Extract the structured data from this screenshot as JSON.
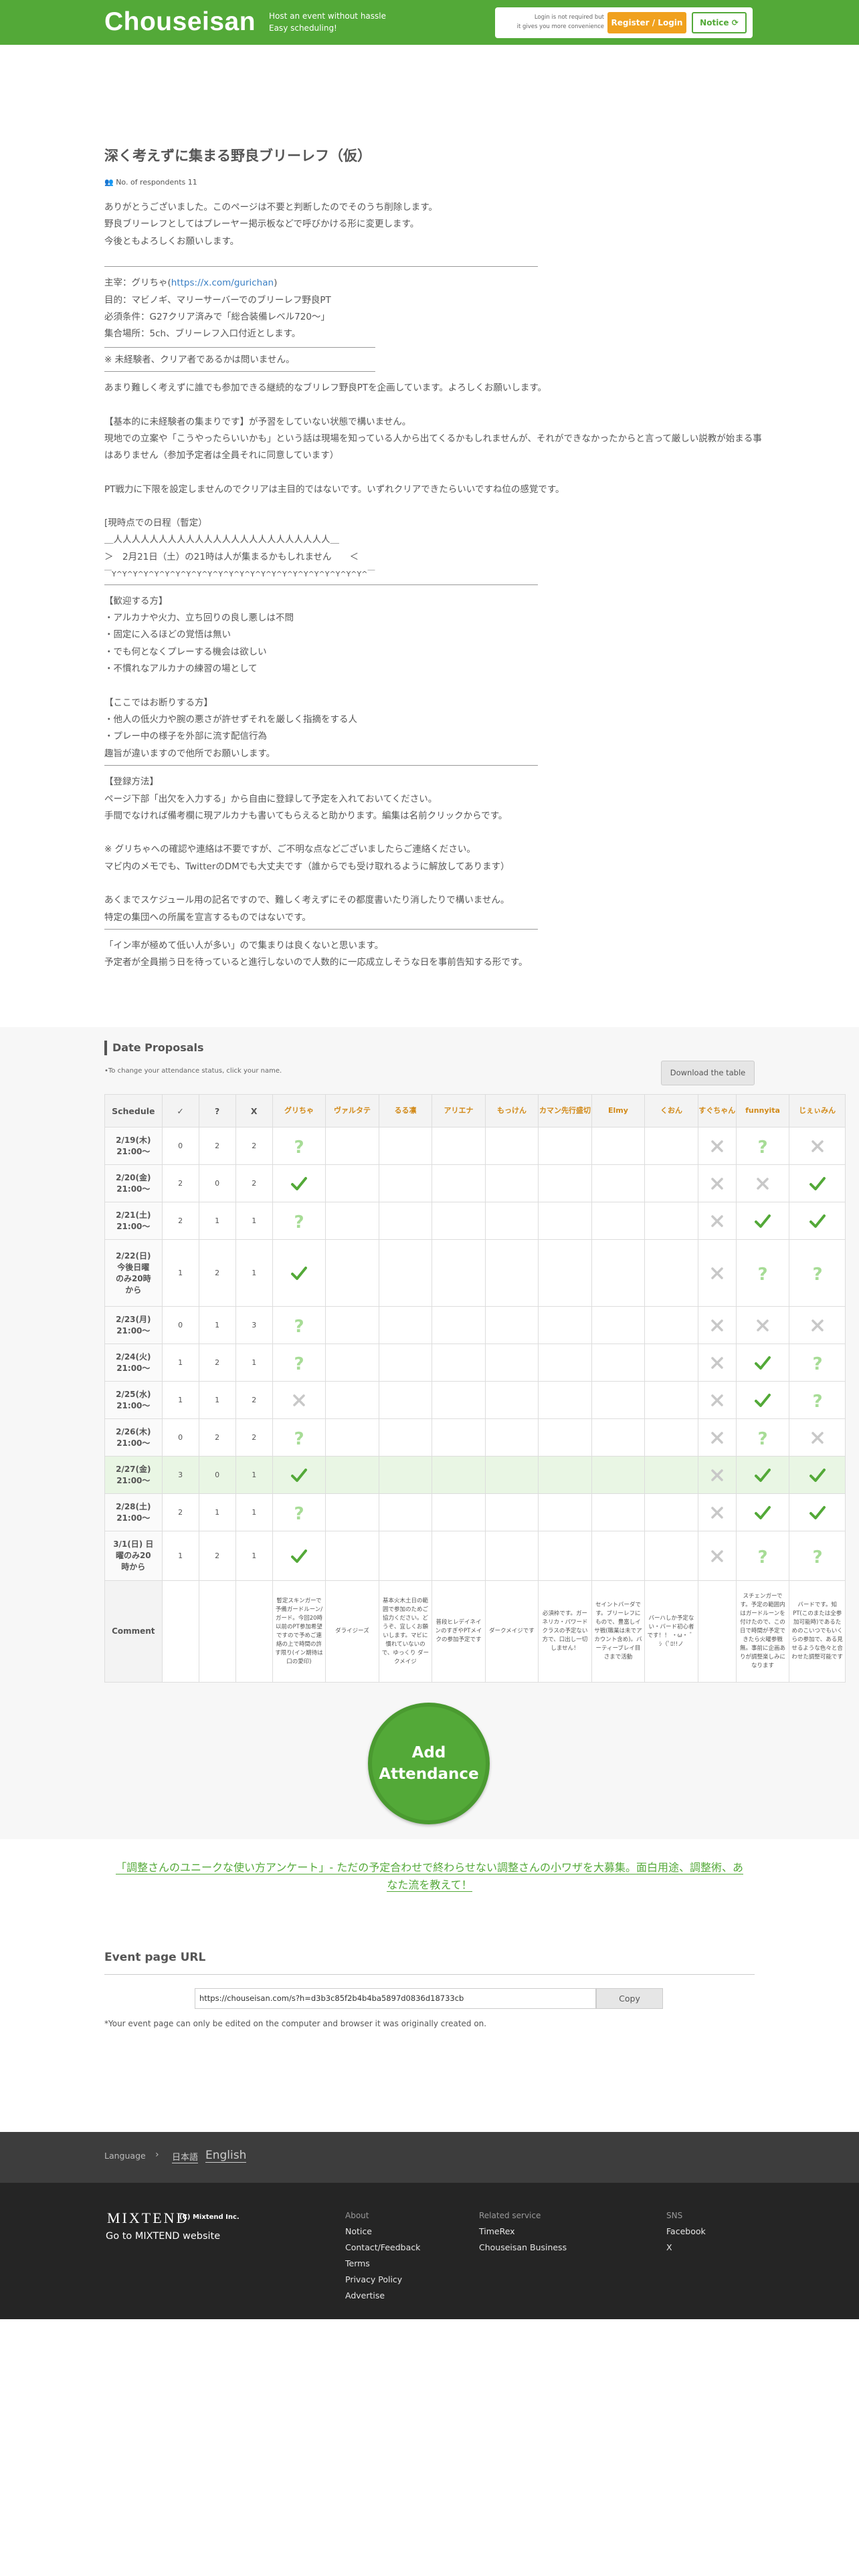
{
  "header": {
    "logo": "Chouseisan",
    "tagline_1": "Host an event without hassle",
    "tagline_2": "Easy scheduling!",
    "login_note_1": "Login is not required but",
    "login_note_2": "it gives you more convenience",
    "register_label": "Register / Login",
    "notice_label": "Notice"
  },
  "event": {
    "title": "深く考えずに集まる野良ブリーレフ（仮）",
    "respondents": "No. of respondents 11",
    "memo_lines": [
      "ありがとうございました。このページは不要と判断したのでそのうち削除します。",
      "野良ブリーレフとしてはプレーヤー掲示板などで呼びかける形に変更します。",
      "今後ともよろしくお願いします。",
      "",
      "主宰：グリちゃ",
      "https://x.com/gurichan",
      "目的：マビノギ、マリーサーバーでのブリーレフ野良PT",
      "必須条件：G27クリア済みで「総合装備レベル720～」",
      "集合場所：5ch、ブリーレフ入口付近とします。",
      "※ 未経験者、クリア者であるかは問いません。",
      "あまり難しく考えずに誰でも参加できる継続的なブリレフ野良PTを企画しています。よろしくお願いします。",
      "【基本的に未経験者の集まりです】が予習をしていない状態で構いません。",
      "現地での立案や「こうやったらいいかも」という話は現場を知っている人から出てくるかもしれませんが、それができなかったからと言って厳しい説教が始まる事はありません（参加予定者は全員それに同意しています）",
      "PT戦力に下限を設定しませんのでクリアは主目的ではないです。いずれクリアできたらいいですね位の感覚です。",
      "[現時点での日程（暫定）",
      "＿人人人人人人人人人人人人人人人人人人人人人人人人＿",
      "＞　2月21日（土）の21時は人が集まるかもしれません　　＜",
      "￣Y^Y^Y^Y^Y^Y^Y^Y^Y^Y^Y^Y^Y^Y^Y^Y^Y^Y^Y^Y^Y^Y^Y^Y^￣",
      "【歓迎する方】",
      "・アルカナや火力、立ち回りの良し悪しは不問",
      "・固定に入るほどの覚悟は無い",
      "・でも何となくプレーする機会は欲しい",
      "・不慣れなアルカナの練習の場として",
      "【ここではお断りする方】",
      "・他人の低火力や腕の悪さが許せずそれを厳しく指摘をする人",
      "・プレー中の様子を外部に流す配信行為",
      "趣旨が違いますので他所でお願いします。",
      "【登録方法】",
      "ページ下部「出欠を入力する」から自由に登録して予定を入れておいてください。",
      "手間でなければ備考欄に現アルカナも書いてもらえると助かります。編集は名前クリックからです。",
      "※ グリちゃへの確認や連絡は不要ですが、ご不明な点などございましたらご連絡ください。",
      "マビ内のメモでも、TwitterのDMでも大丈夫です（誰からでも受け取れるように解放してあります）",
      "あくまでスケジュール用の記名ですので、難しく考えずにその都度書いたり消したりで構いません。",
      "特定の集団への所属を宣言するものではないです。",
      "「イン率が極めて低い人が多い」ので集まりは良くないと思います。",
      "予定者が全員揃う日を待っていると進行しないので人数的に一応成立しそうな日を事前告知する形です。"
    ]
  },
  "schedule": {
    "title": "Date Proposals",
    "subtitle": "•To change your attendance status, click your name.",
    "download_label": "Download the table",
    "col_schedule": "Schedule",
    "col_ok": "✓",
    "col_maybe": "?",
    "col_no": "X",
    "comment_label": "Comment",
    "names": [
      "グリちゃ",
      "ヴァルタテ",
      "るる凛",
      "アリエナ",
      "もっけん",
      "カマン先行盛切",
      "Elmy",
      "くおん",
      "すぐちゃん",
      "funnyita",
      "じぇぃみん"
    ],
    "rows": [
      {
        "date": "2/19(木)\n21:00～",
        "ok": "0",
        "maybe": "2",
        "no": "2",
        "marks": [
          "?",
          "",
          "",
          "",
          "",
          "",
          "",
          "",
          "x",
          "?",
          "x"
        ]
      },
      {
        "date": "2/20(金)\n21:00～",
        "ok": "2",
        "maybe": "0",
        "no": "2",
        "marks": [
          "o",
          "",
          "",
          "",
          "",
          "",
          "",
          "",
          "x",
          "x",
          "o"
        ]
      },
      {
        "date": "2/21(土)\n21:00～",
        "ok": "2",
        "maybe": "1",
        "no": "1",
        "marks": [
          "?",
          "",
          "",
          "",
          "",
          "",
          "",
          "",
          "x",
          "o",
          "o"
        ]
      },
      {
        "date": "2/22(日)\n今後日曜\nのみ20時\nから",
        "ok": "1",
        "maybe": "2",
        "no": "1",
        "marks": [
          "o",
          "",
          "",
          "",
          "",
          "",
          "",
          "",
          "x",
          "?",
          "?"
        ]
      },
      {
        "date": "2/23(月)\n21:00～",
        "ok": "0",
        "maybe": "1",
        "no": "3",
        "marks": [
          "?",
          "",
          "",
          "",
          "",
          "",
          "",
          "",
          "x",
          "x",
          "x"
        ]
      },
      {
        "date": "2/24(火)\n21:00～",
        "ok": "1",
        "maybe": "2",
        "no": "1",
        "marks": [
          "?",
          "",
          "",
          "",
          "",
          "",
          "",
          "",
          "x",
          "o",
          "?"
        ]
      },
      {
        "date": "2/25(水)\n21:00～",
        "ok": "1",
        "maybe": "1",
        "no": "2",
        "marks": [
          "x",
          "",
          "",
          "",
          "",
          "",
          "",
          "",
          "x",
          "o",
          "?"
        ]
      },
      {
        "date": "2/26(木)\n21:00～",
        "ok": "0",
        "maybe": "2",
        "no": "2",
        "marks": [
          "?",
          "",
          "",
          "",
          "",
          "",
          "",
          "",
          "x",
          "?",
          "x"
        ]
      },
      {
        "date": "2/27(金)\n21:00～",
        "ok": "3",
        "maybe": "0",
        "no": "1",
        "marks": [
          "o",
          "",
          "",
          "",
          "",
          "",
          "",
          "",
          "x",
          "o",
          "o"
        ],
        "highlight": true
      },
      {
        "date": "2/28(土)\n21:00～",
        "ok": "2",
        "maybe": "1",
        "no": "1",
        "marks": [
          "?",
          "",
          "",
          "",
          "",
          "",
          "",
          "",
          "x",
          "o",
          "o"
        ]
      },
      {
        "date": "3/1(日) 日\n曜のみ20\n時から",
        "ok": "1",
        "maybe": "2",
        "no": "1",
        "marks": [
          "o",
          "",
          "",
          "",
          "",
          "",
          "",
          "",
          "x",
          "?",
          "?"
        ]
      }
    ],
    "comments": [
      "暫定スキンガーで予備ガードルーン/ガード。今回20時以前のPT参加希望ですので予めご連絡の上で時間の許す限り(イン期待は口の愛印)",
      "ダライジーズ",
      "基本火木土日の範囲で参加のためご協力ください。どうぞ、宜しくお願いします。マビに慣れていないので、ゆっくり ダークメイジ",
      "普段ヒレデイネインのすぎやPTメイクの参加予定です",
      "ダークメイジです",
      "必須枠です。ガーネリカ・パワードクラスの予定ない方で、口出し一切しません！",
      "セイントバーダです。ブリーレフにもので、豊富しイサ戦(職業は未でアカウント含め)。バーティーブレイ目さまで活動",
      "バーハしか予定ない・バード初心者です！！ ・ω・ ゛ ｼ（ﾟﾛ!!ノ",
      "",
      "スチェンガーです。予定の範囲内はガードルーンを付けたので、この日で時間が予定できたら火曜参戦無。事前に企画ありが調整楽しみになります",
      "バードです。知PT(このまたは全参加可能時)であるためのこいつでもいくらの参加で、ある見せるような色々と合わせた調整可能です"
    ],
    "add_label_1": "Add",
    "add_label_2": "Attendance"
  },
  "survey": {
    "text": "「調整さんのユニークな使い方アンケート」- ただの予定合わせで終わらせない調整さんの小ワザを大募集。面白用途、調整術、あなた流を教えて！"
  },
  "event_url": {
    "title": "Event page URL",
    "value": "https://chouseisan.com/s?h=d3b3c85f2b4b4ba5897d0836d18733cb",
    "copy_label": "Copy",
    "note": "*Your event page can only be edited on the computer and browser it was originally created on."
  },
  "footer": {
    "language_label": "Language",
    "lang_ja": "日本語",
    "lang_en": "English",
    "brand": "MIXTEND",
    "copyright": "(C) Mixtend Inc.",
    "goto": "Go to MIXTEND website",
    "about_heading": "About",
    "about_items": [
      "Notice",
      "Contact/Feedback",
      "Terms",
      "Privacy Policy",
      "Advertise"
    ],
    "related_heading": "Related service",
    "related_items": [
      "TimeRex",
      "Chouseisan Business"
    ],
    "sns_heading": "SNS",
    "sns_items": [
      "Facebook",
      "X"
    ]
  },
  "colors": {
    "brand_green": "#53a938",
    "accent_orange": "#f0a11e",
    "name_orange": "#d28a19",
    "mark_gray": "#c8c8c8"
  }
}
